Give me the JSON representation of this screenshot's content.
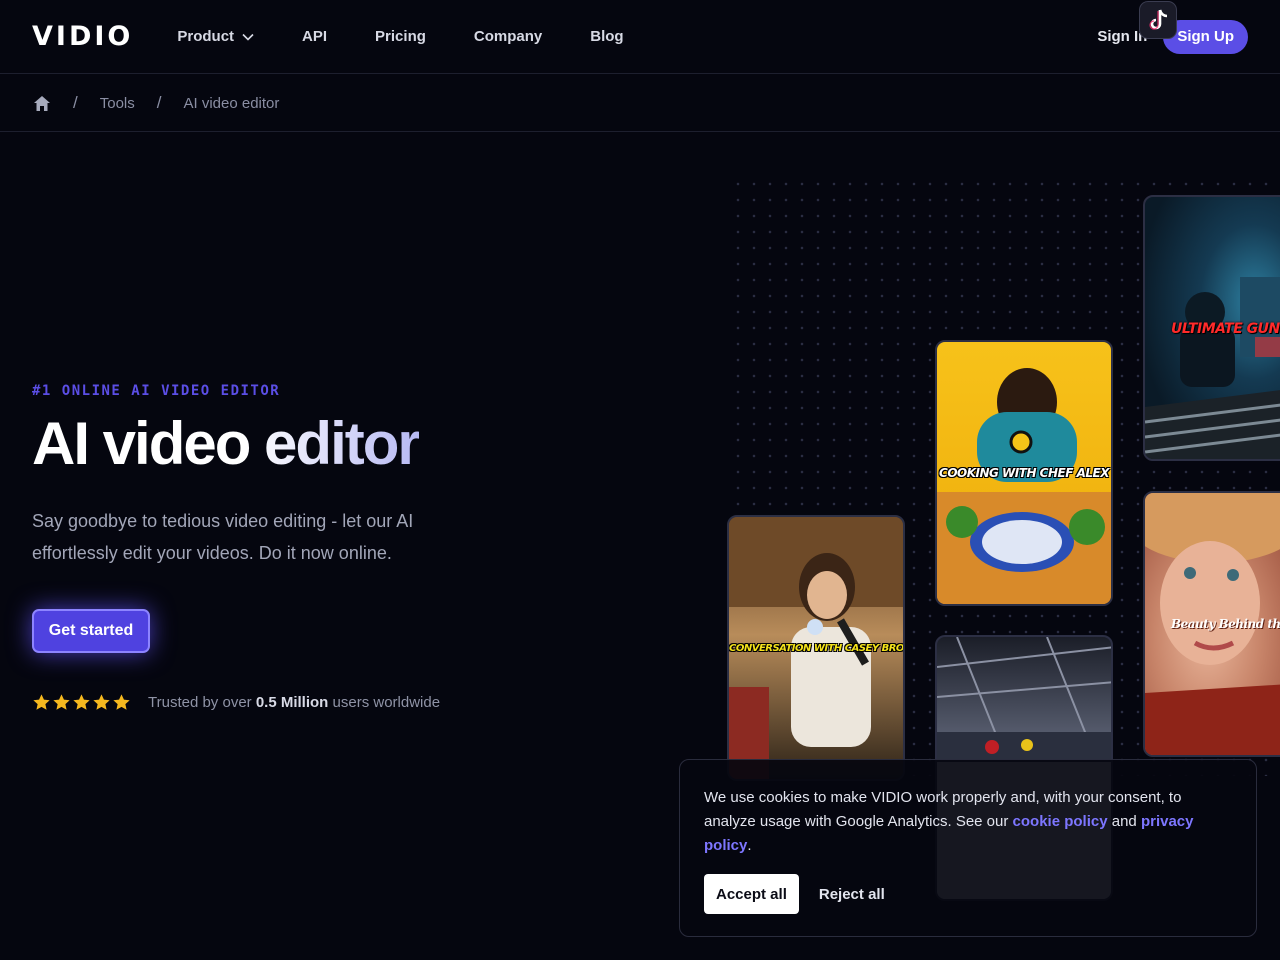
{
  "header": {
    "logo": "VIDIO",
    "nav": [
      {
        "label": "Product"
      },
      {
        "label": "API"
      },
      {
        "label": "Pricing"
      },
      {
        "label": "Company"
      },
      {
        "label": "Blog"
      }
    ],
    "sign_in": "Sign In",
    "sign_up": "Sign Up"
  },
  "breadcrumb": {
    "items": [
      "Tools",
      "AI video editor"
    ],
    "separator": "/"
  },
  "hero": {
    "eyebrow": "#1 ONLINE AI VIDEO EDITOR",
    "title": "AI video editor",
    "subtitle": "Say goodbye to tedious video editing - let our AI effortlessly edit your videos. Do it now online.",
    "cta": "Get started",
    "rating_stars": 5,
    "trust_prefix": "Trusted by over ",
    "trust_bold": "0.5 Million",
    "trust_suffix": " users worldwide"
  },
  "videos": {
    "gaming_caption": "ULTIMATE GUNFIGHT",
    "cooking_caption": "COOKING WITH CHEF ALEX",
    "beauty_caption": "Beauty Behind the Scenes",
    "podcast_caption": "CONVERSATION WITH CASEY BROWN"
  },
  "cookie": {
    "text_1": "We use cookies to make VIDIO work properly and, with your consent, to analyze usage with Google Analytics. See our ",
    "cookie_link": "cookie policy",
    "text_2": " and ",
    "privacy_link": "privacy policy",
    "text_3": ".",
    "accept": "Accept all",
    "reject": "Reject all"
  },
  "colors": {
    "background": "#05060f",
    "accent": "#5b4ee6",
    "link": "#7d76ff",
    "star": "#f5b81f"
  }
}
